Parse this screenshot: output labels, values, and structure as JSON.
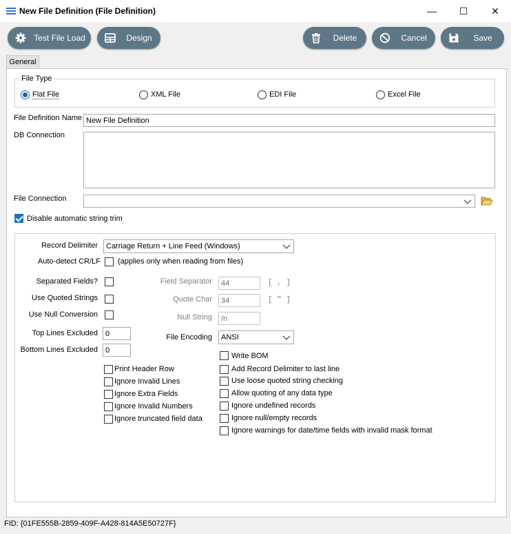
{
  "window": {
    "title": "New File Definition (File Definition)",
    "minimize_glyph": "—",
    "maximize_glyph": "☐",
    "close_glyph": "✕"
  },
  "toolbar": {
    "test_file_load": "Test File Load",
    "design": "Design",
    "delete": "Delete",
    "cancel": "Cancel",
    "save": "Save"
  },
  "tabs": [
    {
      "label": "General"
    }
  ],
  "file_type": {
    "legend": "File Type",
    "options": [
      "Flat File",
      "XML File",
      "EDI File",
      "Excel File"
    ],
    "selected": "Flat File"
  },
  "form": {
    "file_definition_name_label": "File Definition Name",
    "file_definition_name_value": "New File Definition",
    "db_connection_label": "DB Connection",
    "db_connection_value": "",
    "file_connection_label": "File Connection",
    "file_connection_value": "",
    "disable_trim_label": "Disable automatic string trim",
    "disable_trim_checked": true
  },
  "flat": {
    "record_delimiter_label": "Record Delimiter",
    "record_delimiter_value": "Carriage Return + Line Feed (Windows)",
    "auto_detect_label": "Auto-detect CR/LF",
    "auto_detect_note": "(applies only when reading from files)",
    "separated_fields_label": "Separated Fields?",
    "use_quoted_strings_label": "Use Quoted Strings",
    "use_null_conversion_label": "Use Null Conversion",
    "top_lines_excluded_label": "Top Lines Excluded",
    "top_lines_excluded_value": "0",
    "bottom_lines_excluded_label": "Bottom Lines Excluded",
    "bottom_lines_excluded_value": "0",
    "field_separator_label": "Field Separator",
    "field_separator_value": "44",
    "field_separator_char": "[ , ]",
    "quote_char_label": "Quote Char",
    "quote_char_value": "34",
    "quote_char_char": "[ \" ]",
    "null_string_label": "Null String",
    "null_string_value": "/n",
    "file_encoding_label": "File Encoding",
    "file_encoding_value": "ANSI",
    "write_bom_label": "Write BOM",
    "left_options": [
      "Print Header Row",
      "Ignore Invalid Lines",
      "Ignore Extra Fields",
      "Ignore Invalid Numbers",
      "Ignore truncated field data"
    ],
    "right_options": [
      "Add Record Delimiter to last line",
      "Use loose quoted string checking",
      "Allow quoting of any data type",
      "Ignore undefined records",
      "Ignore null/empty records",
      "Ignore warnings for date/time fields with invalid mask format"
    ]
  },
  "status": {
    "fid": "FID: {01FE555B-2859-409F-A428-814A5E50727F}"
  },
  "colors": {
    "toolbar_button": "#5d7787",
    "accent": "#1a73c8"
  }
}
